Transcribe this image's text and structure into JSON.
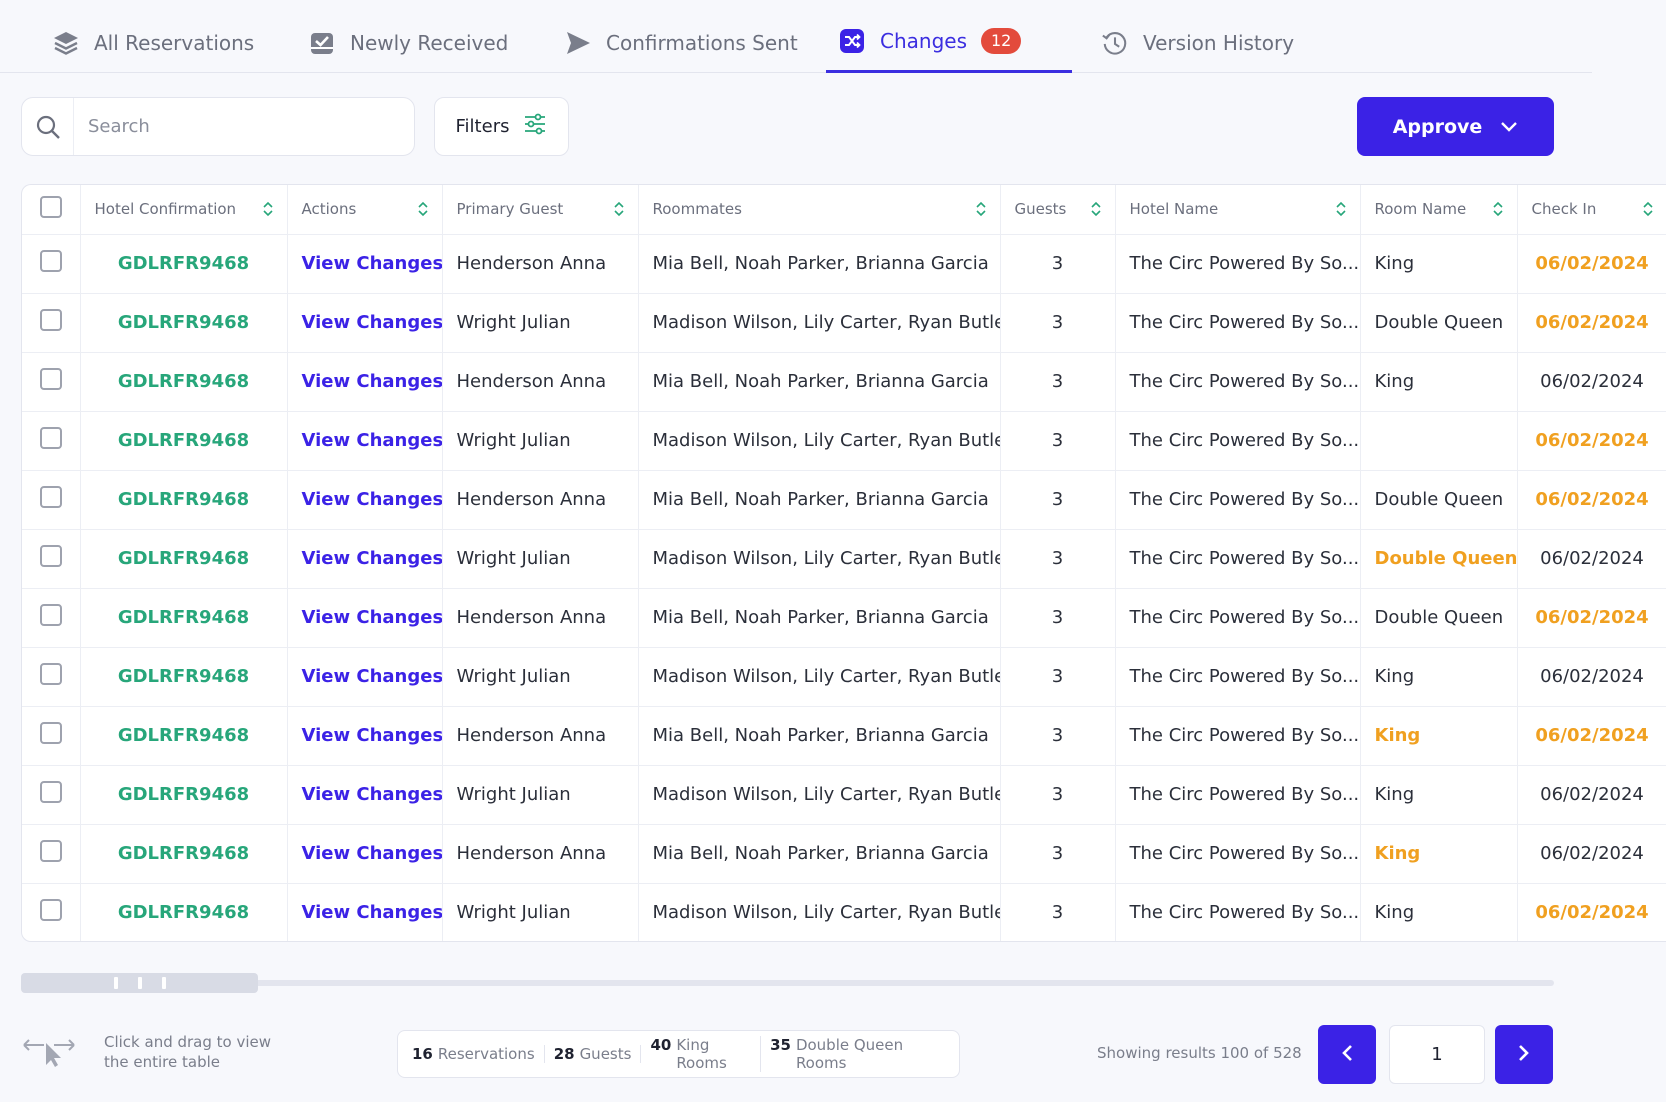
{
  "tabs": [
    {
      "label": "All Reservations",
      "icon": "layers-icon"
    },
    {
      "label": "Newly Received",
      "icon": "inbox-check-icon"
    },
    {
      "label": "Confirmations Sent",
      "icon": "send-icon"
    },
    {
      "label": "Changes",
      "icon": "shuffle-icon",
      "badge": "12",
      "active": true
    },
    {
      "label": "Version History",
      "icon": "history-icon"
    }
  ],
  "toolbar": {
    "search_placeholder": "Search",
    "filters_label": "Filters",
    "approve_label": "Approve"
  },
  "colors": {
    "accent": "#3b22e6",
    "confirmation": "#27a67a",
    "changed": "#f0a020",
    "badge": "#e34b3c"
  },
  "table": {
    "columns": [
      "Hotel Confirmation",
      "Actions",
      "Primary Guest",
      "Roommates",
      "Guests",
      "Hotel Name",
      "Room Name",
      "Check In"
    ],
    "rows": [
      {
        "confirmation": "GDLRFR9468",
        "action": "View Changes",
        "primary": "Henderson Anna",
        "roommates": "Mia Bell, Noah Parker, Brianna Garcia",
        "guests": "3",
        "hotel": "The Circ Powered By So...",
        "room": "King",
        "room_changed": false,
        "checkin": "06/02/2024",
        "checkin_changed": true
      },
      {
        "confirmation": "GDLRFR9468",
        "action": "View Changes",
        "primary": "Wright Julian",
        "roommates": "Madison Wilson, Lily Carter, Ryan Butler",
        "guests": "3",
        "hotel": "The Circ Powered By So...",
        "room": "Double Queen",
        "room_changed": false,
        "checkin": "06/02/2024",
        "checkin_changed": true
      },
      {
        "confirmation": "GDLRFR9468",
        "action": "View Changes",
        "primary": "Henderson Anna",
        "roommates": "Mia Bell, Noah Parker, Brianna Garcia",
        "guests": "3",
        "hotel": "The Circ Powered By So...",
        "room": "King",
        "room_changed": false,
        "checkin": "06/02/2024",
        "checkin_changed": false
      },
      {
        "confirmation": "GDLRFR9468",
        "action": "View Changes",
        "primary": "Wright Julian",
        "roommates": "Madison Wilson, Lily Carter, Ryan Butler",
        "guests": "3",
        "hotel": "The Circ Powered By So...",
        "room": "",
        "room_changed": false,
        "checkin": "06/02/2024",
        "checkin_changed": true
      },
      {
        "confirmation": "GDLRFR9468",
        "action": "View Changes",
        "primary": "Henderson Anna",
        "roommates": "Mia Bell, Noah Parker, Brianna Garcia",
        "guests": "3",
        "hotel": "The Circ Powered By So...",
        "room": "Double Queen",
        "room_changed": false,
        "checkin": "06/02/2024",
        "checkin_changed": true
      },
      {
        "confirmation": "GDLRFR9468",
        "action": "View Changes",
        "primary": "Wright Julian",
        "roommates": "Madison Wilson, Lily Carter, Ryan Butler",
        "guests": "3",
        "hotel": "The Circ Powered By So...",
        "room": "Double Queen",
        "room_changed": true,
        "checkin": "06/02/2024",
        "checkin_changed": false
      },
      {
        "confirmation": "GDLRFR9468",
        "action": "View Changes",
        "primary": "Henderson Anna",
        "roommates": "Mia Bell, Noah Parker, Brianna Garcia",
        "guests": "3",
        "hotel": "The Circ Powered By So...",
        "room": "Double Queen",
        "room_changed": false,
        "checkin": "06/02/2024",
        "checkin_changed": true
      },
      {
        "confirmation": "GDLRFR9468",
        "action": "View Changes",
        "primary": "Wright Julian",
        "roommates": "Madison Wilson, Lily Carter, Ryan Butler",
        "guests": "3",
        "hotel": "The Circ Powered By So...",
        "room": "King",
        "room_changed": false,
        "checkin": "06/02/2024",
        "checkin_changed": false
      },
      {
        "confirmation": "GDLRFR9468",
        "action": "View Changes",
        "primary": "Henderson Anna",
        "roommates": "Mia Bell, Noah Parker, Brianna Garcia",
        "guests": "3",
        "hotel": "The Circ Powered By So...",
        "room": "King",
        "room_changed": true,
        "checkin": "06/02/2024",
        "checkin_changed": true
      },
      {
        "confirmation": "GDLRFR9468",
        "action": "View Changes",
        "primary": "Wright Julian",
        "roommates": "Madison Wilson, Lily Carter, Ryan Butler",
        "guests": "3",
        "hotel": "The Circ Powered By So...",
        "room": "King",
        "room_changed": false,
        "checkin": "06/02/2024",
        "checkin_changed": false
      },
      {
        "confirmation": "GDLRFR9468",
        "action": "View Changes",
        "primary": "Henderson Anna",
        "roommates": "Mia Bell, Noah Parker, Brianna Garcia",
        "guests": "3",
        "hotel": "The Circ Powered By So...",
        "room": "King",
        "room_changed": true,
        "checkin": "06/02/2024",
        "checkin_changed": false
      },
      {
        "confirmation": "GDLRFR9468",
        "action": "View Changes",
        "primary": "Wright Julian",
        "roommates": "Madison Wilson, Lily Carter, Ryan Butler",
        "guests": "3",
        "hotel": "The Circ Powered By So...",
        "room": "King",
        "room_changed": false,
        "checkin": "06/02/2024",
        "checkin_changed": true
      }
    ]
  },
  "footer": {
    "drag_hint": "Click and drag to view the entire table",
    "stats": [
      {
        "value": "16",
        "label": "Reservations"
      },
      {
        "value": "28",
        "label": "Guests"
      },
      {
        "value": "40",
        "label": "King Rooms"
      },
      {
        "value": "35",
        "label": "Double Queen Rooms"
      }
    ],
    "showing": "Showing results 100 of 528",
    "page": "1"
  }
}
